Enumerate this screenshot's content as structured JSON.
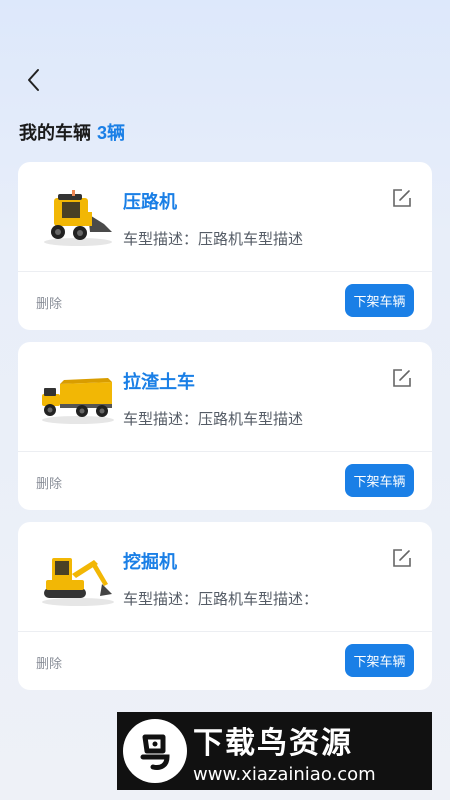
{
  "header": {
    "title": "我的车辆",
    "count": "3辆"
  },
  "vehicles": [
    {
      "name": "压路机",
      "description": "车型描述：压路机车型描述",
      "image_icon": "skid-steer-loader-icon",
      "delete_label": "删除",
      "delist_label": "下架车辆"
    },
    {
      "name": "拉渣土车",
      "description": "车型描述：压路机车型描述",
      "image_icon": "dump-truck-icon",
      "delete_label": "删除",
      "delist_label": "下架车辆"
    },
    {
      "name": "挖掘机",
      "description": "车型描述：压路机车型描述：",
      "image_icon": "excavator-icon",
      "delete_label": "删除",
      "delist_label": "下架车辆"
    }
  ],
  "banner": {
    "name": "下载鸟资源",
    "url": "www.xiazainiao.com"
  },
  "colors": {
    "accent": "#1a7fe6",
    "vehicle_yellow": "#f2b705"
  }
}
